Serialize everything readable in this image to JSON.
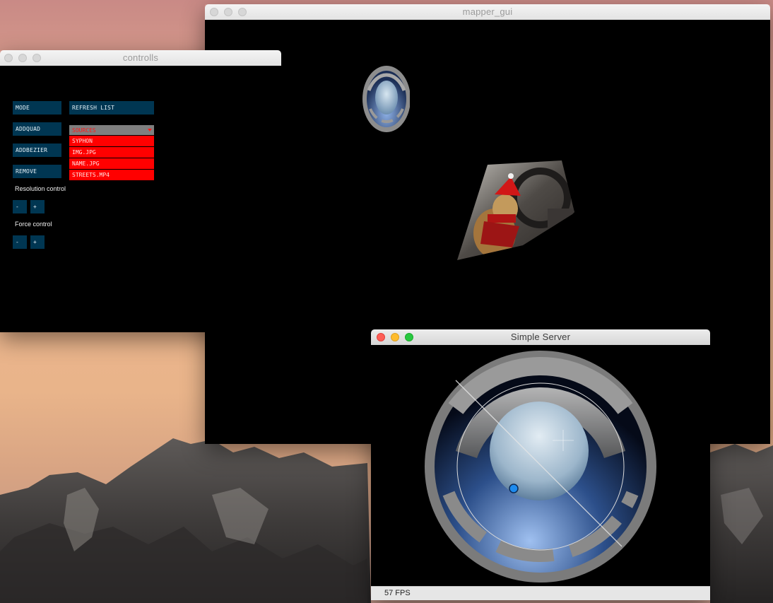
{
  "mapper_window": {
    "title": "mapper_gui"
  },
  "controls_window": {
    "title": "controlls",
    "buttons": {
      "mode": "MODE",
      "addquad": "ADDQUAD",
      "addbezier": "ADDBEZIER",
      "remove": "REMOVE",
      "refresh_list": "REFRESH LIST"
    },
    "sources_dropdown": {
      "header": "SOURCES",
      "items": [
        "SYPHON",
        "IMG.JPG",
        "NAME.JPG",
        "STREETS.MP4"
      ]
    },
    "resolution": {
      "label": "Resolution control",
      "minus": "-",
      "plus": "+"
    },
    "force": {
      "label": "Force control",
      "minus": "-",
      "plus": "+"
    }
  },
  "server_window": {
    "title": "Simple Server",
    "fps": "57 FPS"
  },
  "colors": {
    "button_bg": "#003652",
    "dropdown_item": "#ff0000",
    "dropdown_header": "#7f7f7f",
    "traffic_close": "#fe5f57",
    "traffic_min": "#febc2e",
    "traffic_max": "#28c840"
  }
}
